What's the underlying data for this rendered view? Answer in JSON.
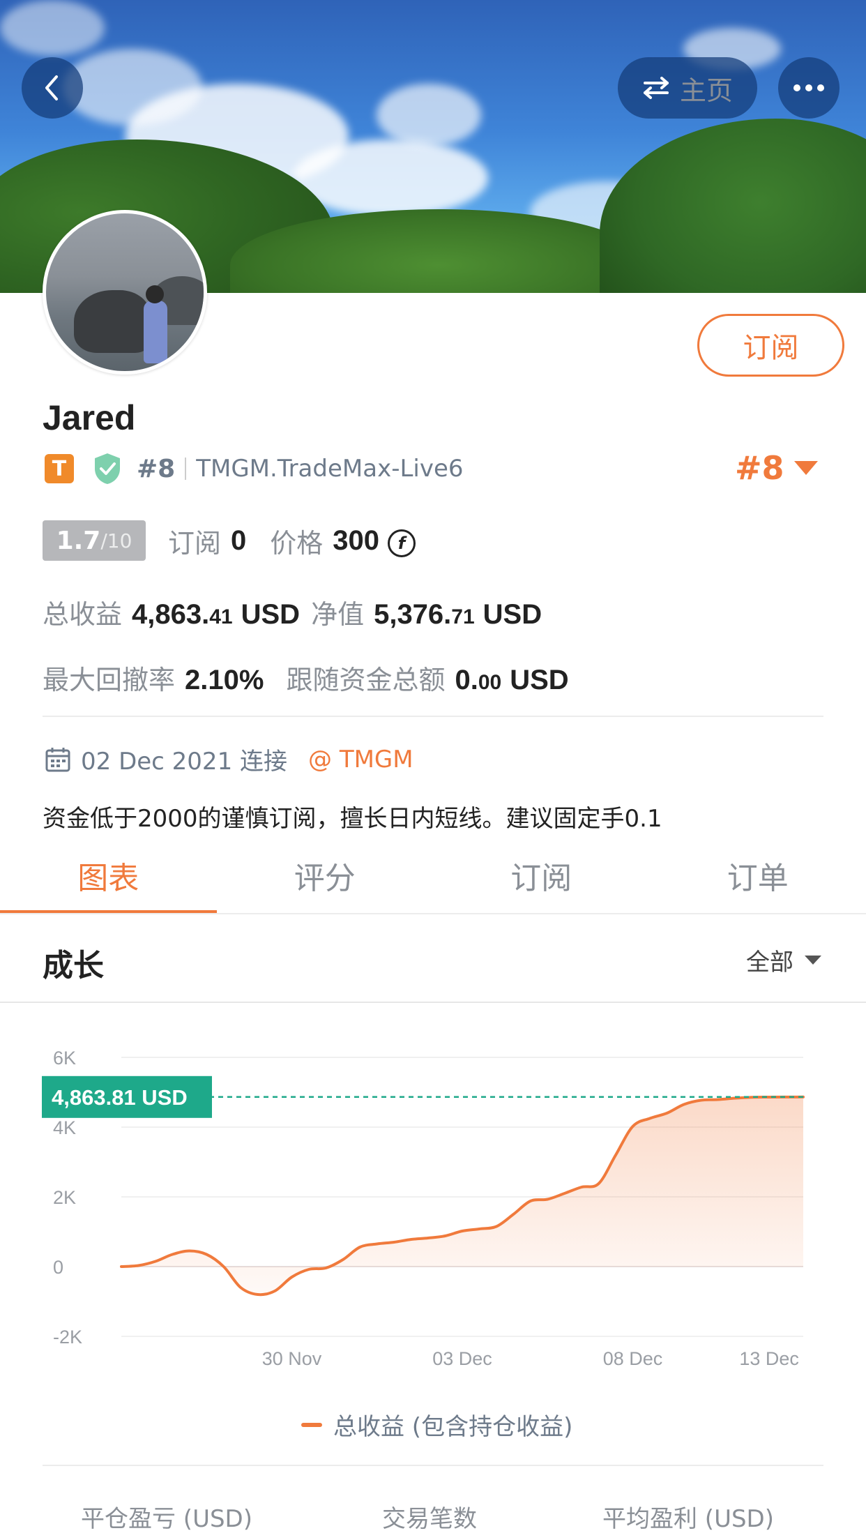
{
  "header": {
    "home_label": "主页",
    "back_icon": "chevron-left-icon",
    "swap_icon": "swap-icon",
    "more_icon": "more-icon"
  },
  "profile": {
    "name": "Jared",
    "tier_badge": "T",
    "rank_small": "#8",
    "broker": "TMGM.TradeMax-Live6",
    "rank_big": "#8",
    "subscribe_label": "订阅"
  },
  "stats": {
    "score": "1.7",
    "score_den": "/10",
    "subs_label": "订阅",
    "subs_value": "0",
    "price_label": "价格",
    "price_value": "300",
    "coin_symbol": "f",
    "total_profit_label": "总收益",
    "total_profit_int": "4,863.",
    "total_profit_dec": "41",
    "total_profit_unit": "USD",
    "equity_label": "净值",
    "equity_int": "5,376.",
    "equity_dec": "71",
    "equity_unit": "USD",
    "drawdown_label": "最大回撤率",
    "drawdown_value": "2.10%",
    "follow_label": "跟随资金总额",
    "follow_int": "0.",
    "follow_dec": "00",
    "follow_unit": "USD"
  },
  "connection": {
    "date": "02 Dec 2021 连接",
    "broker_at": "@ TMGM"
  },
  "description": "资金低于2000的谨慎订阅，擅长日内短线。建议固定手0.1",
  "tabs": [
    "图表",
    "评分",
    "订阅",
    "订单"
  ],
  "growth": {
    "title": "成长",
    "range": "全部"
  },
  "colors": {
    "accent": "#f07a3c",
    "teal": "#1ea98a",
    "muted": "#8a8f96"
  },
  "chart_data": {
    "type": "area",
    "current_label": "4,863.81 USD",
    "current_value": 4863.81,
    "ylim": [
      -2000,
      6000
    ],
    "yticks": [
      {
        "v": 6000,
        "label": "6K"
      },
      {
        "v": 4000,
        "label": "4K"
      },
      {
        "v": 2000,
        "label": "2K"
      },
      {
        "v": 0,
        "label": "0"
      },
      {
        "v": -2000,
        "label": "-2K"
      }
    ],
    "xticks": [
      {
        "x": 5,
        "label": "30 Nov"
      },
      {
        "x": 10,
        "label": "03 Dec"
      },
      {
        "x": 15,
        "label": "08 Dec"
      },
      {
        "x": 19,
        "label": "13 Dec"
      }
    ],
    "xlim": [
      0,
      20
    ],
    "series": [
      {
        "name": "总收益 (包含持仓收益)",
        "points": [
          [
            0,
            0
          ],
          [
            0.5,
            30
          ],
          [
            1,
            150
          ],
          [
            1.5,
            350
          ],
          [
            2,
            450
          ],
          [
            2.5,
            350
          ],
          [
            3,
            0
          ],
          [
            3.5,
            -600
          ],
          [
            4,
            -800
          ],
          [
            4.5,
            -700
          ],
          [
            5,
            -300
          ],
          [
            5.5,
            -80
          ],
          [
            6,
            -40
          ],
          [
            6.5,
            200
          ],
          [
            7,
            560
          ],
          [
            7.5,
            650
          ],
          [
            8,
            700
          ],
          [
            8.5,
            780
          ],
          [
            9,
            820
          ],
          [
            9.5,
            880
          ],
          [
            10,
            1020
          ],
          [
            10.5,
            1080
          ],
          [
            11,
            1150
          ],
          [
            11.5,
            1500
          ],
          [
            12,
            1880
          ],
          [
            12.5,
            1930
          ],
          [
            13,
            2100
          ],
          [
            13.5,
            2280
          ],
          [
            14,
            2380
          ],
          [
            14.5,
            3200
          ],
          [
            15,
            4020
          ],
          [
            15.5,
            4250
          ],
          [
            16,
            4400
          ],
          [
            16.5,
            4650
          ],
          [
            17,
            4770
          ],
          [
            17.5,
            4790
          ],
          [
            18,
            4830
          ],
          [
            18.5,
            4855
          ],
          [
            19,
            4860
          ],
          [
            20,
            4863.81
          ]
        ]
      }
    ],
    "legend": "总收益 (包含持仓收益)"
  },
  "footer_stats": {
    "close_pnl": "平仓盈亏 (USD)",
    "trades": "交易笔数",
    "avg_profit": "平均盈利 (USD)"
  }
}
